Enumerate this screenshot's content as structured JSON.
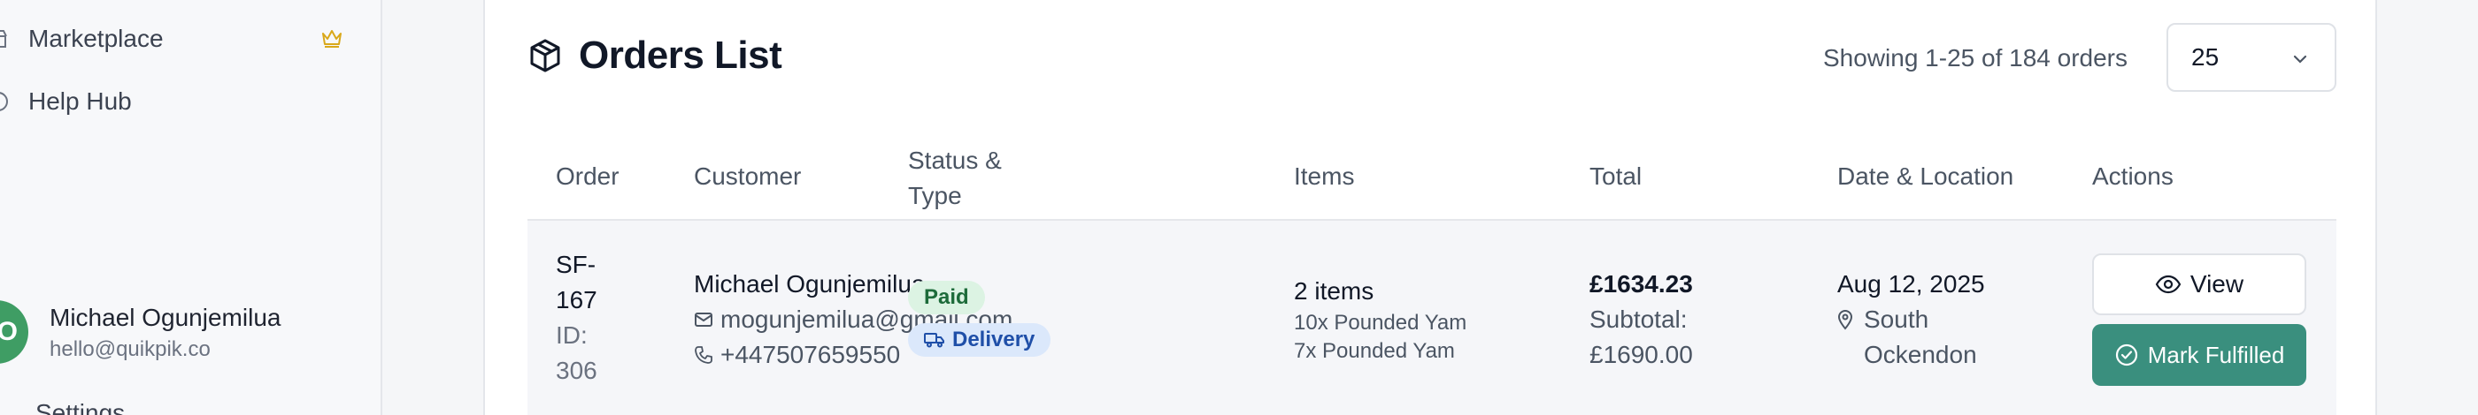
{
  "sidebar": {
    "items": [
      {
        "label": "Marketplace",
        "icon": "store-icon",
        "badge_icon": "crown-icon"
      },
      {
        "label": "Help Hub",
        "icon": "help-icon"
      }
    ],
    "user": {
      "initial": "O",
      "name": "Michael Ogunjemilua",
      "email": "hello@quikpik.co"
    },
    "bottom_label": "Settings"
  },
  "main": {
    "title": "Orders List",
    "title_icon": "package-icon",
    "showing_text": "Showing 1-25 of 184 orders",
    "page_size": "25",
    "columns": [
      "Order",
      "Customer",
      "Status &\nType",
      "Items",
      "Total",
      "Date & Location",
      "Actions"
    ],
    "rows": [
      {
        "order_number": "SF-\n167",
        "order_id": "ID:\n306",
        "customer_name": "Michael Ogunjemilua",
        "customer_email": "mogunjemilua@gmail.com",
        "customer_phone": "+447507659550",
        "status": "Paid",
        "type": "Delivery",
        "items_count": "2 items",
        "item_lines": [
          "10x Pounded Yam",
          "7x Pounded Yam"
        ],
        "total": "£1634.23",
        "subtotal": "Subtotal:\n£1690.00",
        "date": "Aug 12, 2025",
        "location": "South\nOckendon",
        "view_label": "View",
        "fulfil_label": "Mark Fulfilled"
      }
    ]
  },
  "colors": {
    "accent": "#3a8f7e",
    "paid_bg": "#dcf3e3",
    "delivery_bg": "#dbe8fb",
    "avatar": "#3f9d64",
    "crown": "#d9a81a"
  }
}
